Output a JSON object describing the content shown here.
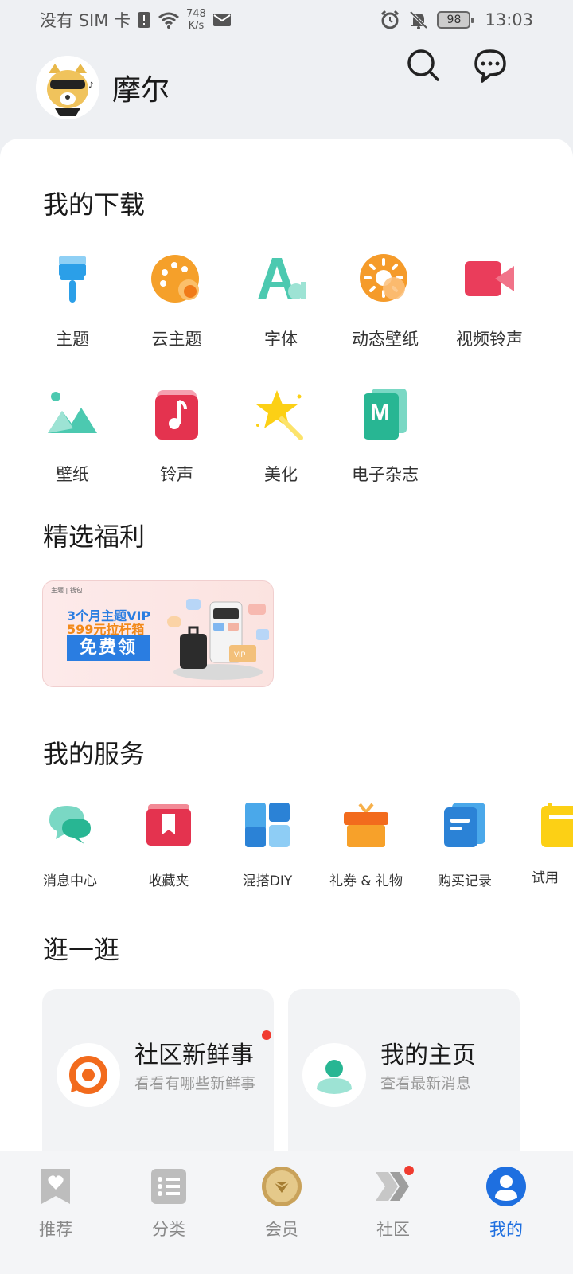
{
  "status_bar": {
    "carrier": "没有 SIM 卡",
    "speed_value": "748",
    "speed_unit": "K/s",
    "battery": "98",
    "time": "13:03"
  },
  "profile": {
    "name": "摩尔"
  },
  "downloads": {
    "title": "我的下载",
    "items": [
      {
        "label": "主题",
        "icon": "paint-brush-icon"
      },
      {
        "label": "云主题",
        "icon": "cloud-theme-icon"
      },
      {
        "label": "字体",
        "icon": "font-icon"
      },
      {
        "label": "动态壁纸",
        "icon": "live-wallpaper-icon"
      },
      {
        "label": "视频铃声",
        "icon": "video-ringtone-icon"
      },
      {
        "label": "壁纸",
        "icon": "wallpaper-icon"
      },
      {
        "label": "铃声",
        "icon": "ringtone-icon"
      },
      {
        "label": "美化",
        "icon": "beautify-star-icon"
      },
      {
        "label": "电子杂志",
        "icon": "magazine-icon"
      }
    ]
  },
  "benefits": {
    "title": "精选福利",
    "banner": {
      "top_text": "主题 | 钱包",
      "line1": "3个月主题VIP",
      "line2": "599元拉杆箱",
      "button": "免费领"
    }
  },
  "services": {
    "title": "我的服务",
    "items": [
      {
        "label": "消息中心",
        "icon": "message-center-icon"
      },
      {
        "label": "收藏夹",
        "icon": "favorites-icon"
      },
      {
        "label": "混搭DIY",
        "icon": "diy-icon"
      },
      {
        "label": "礼券 & 礼物",
        "icon": "gift-icon"
      },
      {
        "label": "购买记录",
        "icon": "purchase-record-icon"
      },
      {
        "label": "试用",
        "icon": "trial-icon"
      }
    ]
  },
  "explore": {
    "title": "逛一逛",
    "cards": [
      {
        "title": "社区新鲜事",
        "subtitle": "看看有哪些新鲜事"
      },
      {
        "title": "我的主页",
        "subtitle": "查看最新消息"
      }
    ]
  },
  "bottom_nav": {
    "items": [
      {
        "label": "推荐",
        "icon": "recommend-icon",
        "active": false
      },
      {
        "label": "分类",
        "icon": "category-icon",
        "active": false
      },
      {
        "label": "会员",
        "icon": "member-icon",
        "active": false
      },
      {
        "label": "社区",
        "icon": "community-icon",
        "active": false
      },
      {
        "label": "我的",
        "icon": "profile-icon",
        "active": true
      }
    ]
  },
  "colors": {
    "accent": "#1e6fe0",
    "notification_dot": "#f03b2f",
    "card_bg": "#f2f3f5"
  }
}
